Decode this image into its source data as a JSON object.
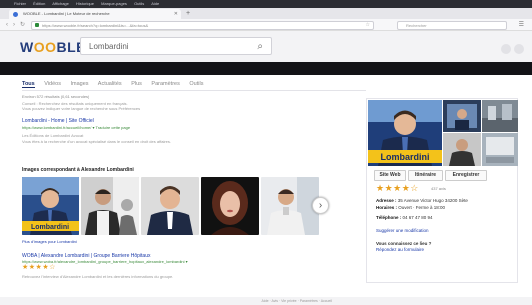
{
  "browser": {
    "menu": [
      "Fichier",
      "Édition",
      "Affichage",
      "Historique",
      "Marque-pages",
      "Outils",
      "Aide"
    ],
    "tab_title": "WOOBLE - Lombardini | Le Moteur de recherche",
    "url": "https://www.wooble.fr/search?q=lombardini&ts=...&fa=tous&",
    "search_placeholder": "Rechercher"
  },
  "site": {
    "logo_main": "W",
    "logo_o": "OO",
    "logo_rest": "BLE",
    "query": "Lombardini",
    "nav": [
      "Tous",
      "Vidéos",
      "Images",
      "Actualités",
      "Plus",
      "Paramètres",
      "Outils"
    ],
    "result_count": "Environ 572 résultats (0,61 secondes)",
    "related_line1": "Conseil : Recherchez des résultats uniquement en français.",
    "related_line2": "Vous pouvez indiquer votre langue de recherche sous Préférences",
    "results": [
      {
        "title": "Lombardini - Home | Site Officiel",
        "url": "https://www.lombardini.fr/accueil/home/ ▾  Traduire cette page",
        "snippet1": "Les Éditions de Lombardini Avocat",
        "snippet2": "Vous êtes à la recherche d'un avocat spécialisé dans le conseil en droit des affaires."
      },
      {
        "title": "WOBA | Alexandre Lombardini | Groupe Barriere Hôpitaux",
        "url": "https://www.woba.fr/alexandre_lombardini_groupe_barriere_hopitaux_alexandre_lombardini ▾",
        "snippet1": "Retrouvez l'interview d'Alexandre Lombardini et les dernières informations du groupe.",
        "snippet2": ""
      }
    ],
    "images_heading": "Images correspondant à Alexandre Lombardini",
    "more_images": "Plus d'images pour Lombardini",
    "thumb_caption": "Lombardini",
    "footer": "Aide  ·  Avis  ·  Vie privée  ·  Paramètres  ·  Accueil"
  },
  "panel": {
    "brand_text": "Lombardini",
    "buttons": [
      "Site Web",
      "Itinéraire",
      "Enregistrer"
    ],
    "reviews": "437 avis",
    "address_label": "Adresse :",
    "address_value": "35 Avenue Victor Hugo 34200 Sète",
    "hours_label": "Horaires :",
    "hours_value": "Ouvert · Ferme à 18:00",
    "phone_label": "Téléphone :",
    "phone_value": "04 67 47 80 94",
    "suggest": "Suggérer une modification",
    "know_heading": "Vous connaissez ce lieu ?",
    "know_link": "Répondez au formulaire"
  },
  "colors": {
    "accent": "#253e7c",
    "orange": "#e8a020",
    "link": "#1a39a8",
    "url_green": "#3a8a3a"
  }
}
